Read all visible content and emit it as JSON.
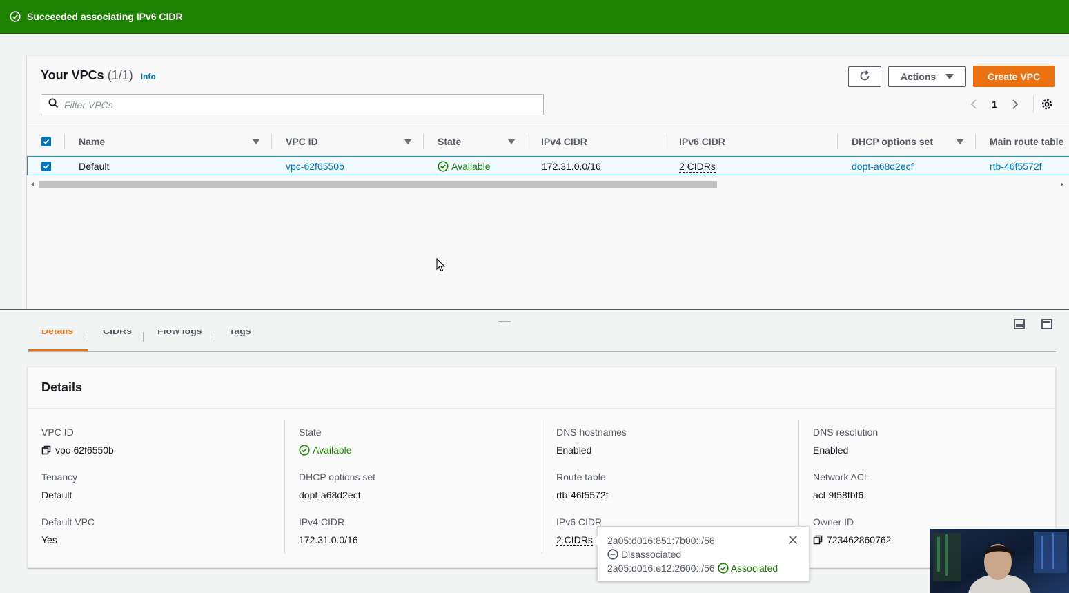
{
  "flash": {
    "message": "Succeeded associating IPv6 CIDR"
  },
  "vpc_panel": {
    "title": "Your VPCs",
    "count": "(1/1)",
    "info": "Info",
    "actions_label": "Actions",
    "create_label": "Create VPC",
    "filter_placeholder": "Filter VPCs",
    "page": "1",
    "columns": [
      "Name",
      "VPC ID",
      "State",
      "IPv4 CIDR",
      "IPv6 CIDR",
      "DHCP options set",
      "Main route table"
    ],
    "rows": [
      {
        "name": "Default",
        "vpc_id": "vpc-62f6550b",
        "state": "Available",
        "ipv4_cidr": "172.31.0.0/16",
        "ipv6_cidr": "2 CIDRs",
        "dhcp_options": "dopt-a68d2ecf",
        "main_route_table": "rtb-46f5572f"
      }
    ]
  },
  "tabs": [
    "Details",
    "CIDRs",
    "Flow logs",
    "Tags"
  ],
  "details": {
    "title": "Details",
    "fields": {
      "vpc_id": {
        "label": "VPC ID",
        "value": "vpc-62f6550b"
      },
      "state": {
        "label": "State",
        "value": "Available"
      },
      "dns_hostnames": {
        "label": "DNS hostnames",
        "value": "Enabled"
      },
      "dns_resolution": {
        "label": "DNS resolution",
        "value": "Enabled"
      },
      "tenancy": {
        "label": "Tenancy",
        "value": "Default"
      },
      "dhcp_options": {
        "label": "DHCP options set",
        "value": "dopt-a68d2ecf"
      },
      "route_table": {
        "label": "Route table",
        "value": "rtb-46f5572f"
      },
      "network_acl": {
        "label": "Network ACL",
        "value": "acl-9f58fbf6"
      },
      "default_vpc": {
        "label": "Default VPC",
        "value": "Yes"
      },
      "ipv4_cidr": {
        "label": "IPv4 CIDR",
        "value": "172.31.0.0/16"
      },
      "ipv6_cidr": {
        "label": "IPv6 CIDR",
        "value": "2 CIDRs"
      },
      "owner_id": {
        "label": "Owner ID",
        "value": "723462860762"
      }
    }
  },
  "popover": {
    "cidr1": "2a05:d016:851:7b00::/56",
    "cidr1_status": "Disassociated",
    "cidr2": "2a05:d016:e12:2600::/56",
    "cidr2_status": "Associated"
  },
  "colors": {
    "success_green": "#1d8102",
    "link_blue": "#0073bb",
    "primary_orange": "#ec7211"
  }
}
